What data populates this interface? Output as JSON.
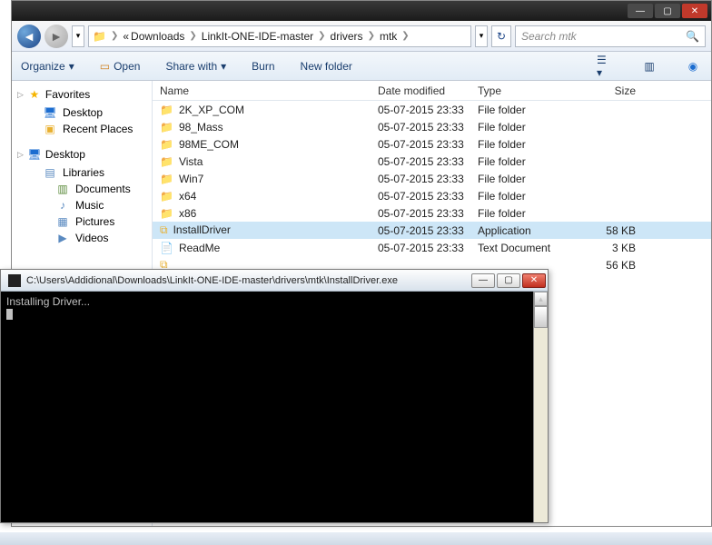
{
  "window": {
    "min": "—",
    "max": "▢",
    "close": "✕"
  },
  "breadcrumb": {
    "items": [
      "Downloads",
      "LinkIt-ONE-IDE-master",
      "drivers",
      "mtk"
    ]
  },
  "search": {
    "placeholder": "Search mtk"
  },
  "toolbar": {
    "organize": "Organize",
    "open": "Open",
    "share": "Share with",
    "burn": "Burn",
    "newfolder": "New folder"
  },
  "sidebar": {
    "favorites": {
      "label": "Favorites",
      "items": [
        "Desktop",
        "Recent Places"
      ]
    },
    "desktop": {
      "label": "Desktop",
      "libraries": {
        "label": "Libraries",
        "items": [
          "Documents",
          "Music",
          "Pictures",
          "Videos"
        ]
      }
    }
  },
  "columns": {
    "name": "Name",
    "date": "Date modified",
    "type": "Type",
    "size": "Size"
  },
  "rows": [
    {
      "icon": "folder",
      "name": "2K_XP_COM",
      "date": "05-07-2015 23:33",
      "type": "File folder",
      "size": ""
    },
    {
      "icon": "folder",
      "name": "98_Mass",
      "date": "05-07-2015 23:33",
      "type": "File folder",
      "size": ""
    },
    {
      "icon": "folder",
      "name": "98ME_COM",
      "date": "05-07-2015 23:33",
      "type": "File folder",
      "size": ""
    },
    {
      "icon": "folder",
      "name": "Vista",
      "date": "05-07-2015 23:33",
      "type": "File folder",
      "size": ""
    },
    {
      "icon": "folder",
      "name": "Win7",
      "date": "05-07-2015 23:33",
      "type": "File folder",
      "size": ""
    },
    {
      "icon": "folder",
      "name": "x64",
      "date": "05-07-2015 23:33",
      "type": "File folder",
      "size": ""
    },
    {
      "icon": "folder",
      "name": "x86",
      "date": "05-07-2015 23:33",
      "type": "File folder",
      "size": ""
    },
    {
      "icon": "app",
      "name": "InstallDriver",
      "date": "05-07-2015 23:33",
      "type": "Application",
      "size": "58 KB",
      "selected": true
    },
    {
      "icon": "txt",
      "name": "ReadMe",
      "date": "05-07-2015 23:33",
      "type": "Text Document",
      "size": "3 KB"
    },
    {
      "icon": "app",
      "name": "",
      "date": "",
      "type": "",
      "size": "56 KB"
    }
  ],
  "console": {
    "title": "C:\\Users\\Addidional\\Downloads\\LinkIt-ONE-IDE-master\\drivers\\mtk\\InstallDriver.exe",
    "line1": "Installing Driver..."
  }
}
